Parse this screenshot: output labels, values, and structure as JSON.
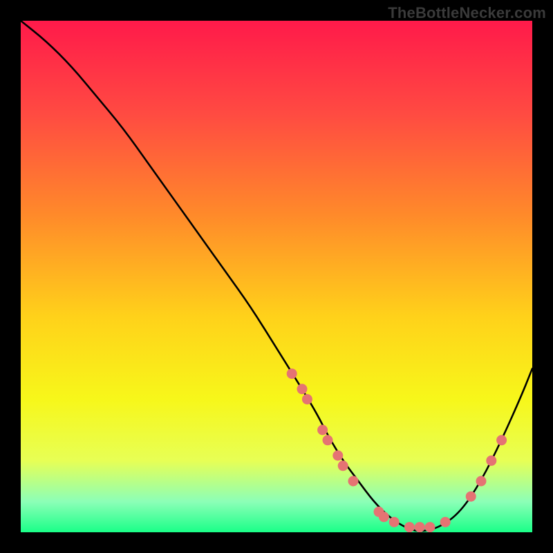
{
  "watermark": "TheBottleNecker.com",
  "colors": {
    "black": "#000000",
    "curve": "#000000",
    "dot_fill": "#e57373",
    "dot_stroke": "#c45a5a"
  },
  "gradient": {
    "stops": [
      {
        "offset": "0%",
        "color": "#ff1a4a"
      },
      {
        "offset": "18%",
        "color": "#ff4a42"
      },
      {
        "offset": "38%",
        "color": "#ff8a2a"
      },
      {
        "offset": "58%",
        "color": "#ffd21a"
      },
      {
        "offset": "74%",
        "color": "#f7f71a"
      },
      {
        "offset": "86%",
        "color": "#e7ff55"
      },
      {
        "offset": "94%",
        "color": "#8cffb7"
      },
      {
        "offset": "100%",
        "color": "#1aff88"
      }
    ]
  },
  "chart_data": {
    "type": "line",
    "title": "",
    "xlabel": "",
    "ylabel": "",
    "xlim": [
      0,
      100
    ],
    "ylim": [
      0,
      100
    ],
    "series": [
      {
        "name": "curve",
        "x": [
          0,
          5,
          10,
          15,
          20,
          25,
          30,
          35,
          40,
          45,
          50,
          55,
          58,
          60,
          63,
          66,
          69,
          72,
          75,
          78,
          82,
          86,
          90,
          94,
          98,
          100
        ],
        "y": [
          100,
          96,
          91,
          85,
          79,
          72,
          65,
          58,
          51,
          44,
          36,
          28,
          23,
          19,
          14,
          10,
          6,
          3,
          1,
          0,
          1,
          4,
          10,
          18,
          27,
          32
        ]
      }
    ],
    "dots": [
      {
        "x": 53,
        "y": 31
      },
      {
        "x": 55,
        "y": 28
      },
      {
        "x": 56,
        "y": 26
      },
      {
        "x": 59,
        "y": 20
      },
      {
        "x": 60,
        "y": 18
      },
      {
        "x": 62,
        "y": 15
      },
      {
        "x": 63,
        "y": 13
      },
      {
        "x": 65,
        "y": 10
      },
      {
        "x": 70,
        "y": 4
      },
      {
        "x": 71,
        "y": 3
      },
      {
        "x": 73,
        "y": 2
      },
      {
        "x": 76,
        "y": 1
      },
      {
        "x": 78,
        "y": 1
      },
      {
        "x": 80,
        "y": 1
      },
      {
        "x": 83,
        "y": 2
      },
      {
        "x": 88,
        "y": 7
      },
      {
        "x": 90,
        "y": 10
      },
      {
        "x": 92,
        "y": 14
      },
      {
        "x": 94,
        "y": 18
      }
    ]
  }
}
